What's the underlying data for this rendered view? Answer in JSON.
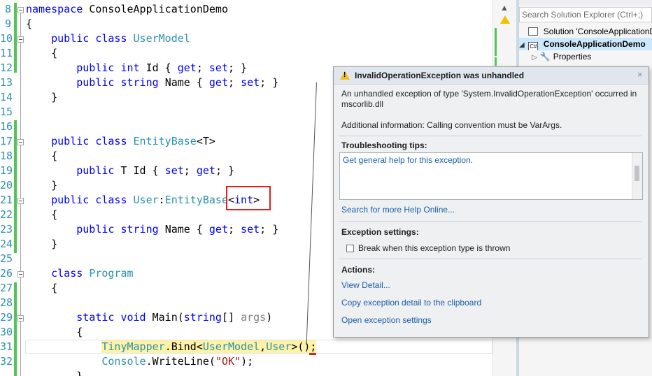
{
  "editor": {
    "line_numbers": [
      "8",
      "9",
      "10",
      "11",
      "12",
      "13",
      "14",
      "15",
      "16",
      "17",
      "18",
      "19",
      "20",
      "21",
      "22",
      "23",
      "24",
      "25",
      "26",
      "27",
      "28",
      "29",
      "30",
      "31",
      "32"
    ],
    "lines": [
      [
        {
          "t": "namespace ",
          "c": "kw"
        },
        {
          "t": "ConsoleApplicationDemo",
          "c": ""
        }
      ],
      [
        {
          "t": "{",
          "c": ""
        }
      ],
      [
        {
          "t": "    public class ",
          "c": "kw"
        },
        {
          "t": "UserModel",
          "c": "ty"
        }
      ],
      [
        {
          "t": "    {",
          "c": ""
        }
      ],
      [
        {
          "t": "        public int ",
          "c": "kw"
        },
        {
          "t": "Id { ",
          "c": ""
        },
        {
          "t": "get",
          "c": "kw"
        },
        {
          "t": "; ",
          "c": ""
        },
        {
          "t": "set",
          "c": "kw"
        },
        {
          "t": "; }",
          "c": ""
        }
      ],
      [
        {
          "t": "        public string ",
          "c": "kw"
        },
        {
          "t": "Name { ",
          "c": ""
        },
        {
          "t": "get",
          "c": "kw"
        },
        {
          "t": "; ",
          "c": ""
        },
        {
          "t": "set",
          "c": "kw"
        },
        {
          "t": "; }",
          "c": ""
        }
      ],
      [
        {
          "t": "    }",
          "c": ""
        }
      ],
      [
        {
          "t": "",
          "c": ""
        }
      ],
      [
        {
          "t": "",
          "c": ""
        }
      ],
      [
        {
          "t": "    public class ",
          "c": "kw"
        },
        {
          "t": "EntityBase",
          "c": "ty"
        },
        {
          "t": "<T>",
          "c": ""
        }
      ],
      [
        {
          "t": "    {",
          "c": ""
        }
      ],
      [
        {
          "t": "        public ",
          "c": "kw"
        },
        {
          "t": "T Id { ",
          "c": ""
        },
        {
          "t": "set",
          "c": "kw"
        },
        {
          "t": "; ",
          "c": ""
        },
        {
          "t": "get",
          "c": "kw"
        },
        {
          "t": "; }",
          "c": ""
        }
      ],
      [
        {
          "t": "    }",
          "c": ""
        }
      ],
      [
        {
          "t": "    public class ",
          "c": "kw"
        },
        {
          "t": "User",
          "c": "ty"
        },
        {
          "t": ":",
          "c": ""
        },
        {
          "t": "EntityBase",
          "c": "ty"
        },
        {
          "t": "<",
          "c": ""
        },
        {
          "t": "int",
          "c": "kw"
        },
        {
          "t": ">",
          "c": ""
        }
      ],
      [
        {
          "t": "    {",
          "c": ""
        }
      ],
      [
        {
          "t": "        public string ",
          "c": "kw"
        },
        {
          "t": "Name { ",
          "c": ""
        },
        {
          "t": "get",
          "c": "kw"
        },
        {
          "t": "; ",
          "c": ""
        },
        {
          "t": "set",
          "c": "kw"
        },
        {
          "t": "; }",
          "c": ""
        }
      ],
      [
        {
          "t": "    }",
          "c": ""
        }
      ],
      [
        {
          "t": "",
          "c": ""
        }
      ],
      [
        {
          "t": "    class ",
          "c": "kw"
        },
        {
          "t": "Program",
          "c": "ty"
        }
      ],
      [
        {
          "t": "    {",
          "c": ""
        }
      ],
      [
        {
          "t": "",
          "c": ""
        }
      ],
      [
        {
          "t": "        static void ",
          "c": "kw"
        },
        {
          "t": "Main(",
          "c": ""
        },
        {
          "t": "string",
          "c": "kw"
        },
        {
          "t": "[] ",
          "c": ""
        },
        {
          "t": "args",
          "c": "gr"
        },
        {
          "t": ")",
          "c": ""
        }
      ],
      [
        {
          "t": "        {",
          "c": ""
        }
      ],
      [
        {
          "t": "            ",
          "c": ""
        },
        {
          "t": "TinyMapper",
          "c": "ty hl"
        },
        {
          "t": ".Bind<",
          "c": "hl"
        },
        {
          "t": "UserModel",
          "c": "ty hl"
        },
        {
          "t": ",",
          "c": "hl"
        },
        {
          "t": "User",
          "c": "ty hl"
        },
        {
          "t": ">();",
          "c": "hl"
        }
      ],
      [
        {
          "t": "            ",
          "c": ""
        },
        {
          "t": "Console",
          "c": "ty"
        },
        {
          "t": ".WriteLine(",
          "c": ""
        },
        {
          "t": "\"OK\"",
          "c": "st"
        },
        {
          "t": ");",
          "c": ""
        }
      ],
      [
        {
          "t": "        }",
          "c": ""
        }
      ]
    ]
  },
  "solution_explorer": {
    "search_placeholder": "Search Solution Explorer (Ctrl+;)",
    "items": [
      {
        "label": "Solution 'ConsoleApplicationD",
        "icon": "solution-icon",
        "selected": false
      },
      {
        "label": "ConsoleApplicationDemo",
        "icon": "csharp-project-icon",
        "selected": true
      },
      {
        "label": "Properties",
        "icon": "wrench-icon",
        "selected": false
      }
    ],
    "project_badge": "C#"
  },
  "exception_popup": {
    "title": "InvalidOperationException was unhandled",
    "message_line1": "An unhandled exception of type 'System.InvalidOperationException' occurred in",
    "message_line2": "mscorlib.dll",
    "additional_info": "Additional information: Calling convention must be VarArgs.",
    "tips_heading": "Troubleshooting tips:",
    "tip_link": "Get general help for this exception.",
    "search_link": "Search for more Help Online...",
    "settings_heading": "Exception settings:",
    "checkbox_label": "Break when this exception type is thrown",
    "checkbox_checked": false,
    "actions_heading": "Actions:",
    "actions": [
      "View Detail...",
      "Copy exception detail to the clipboard",
      "Open exception settings"
    ],
    "close_glyph": "×"
  },
  "colors": {
    "keyword": "#0000ff",
    "type": "#2b91af",
    "string": "#a31515",
    "highlight": "#fdf2a6",
    "link": "#1a5ea8",
    "change_bar": "#54c554",
    "error_box": "#e0201c"
  }
}
